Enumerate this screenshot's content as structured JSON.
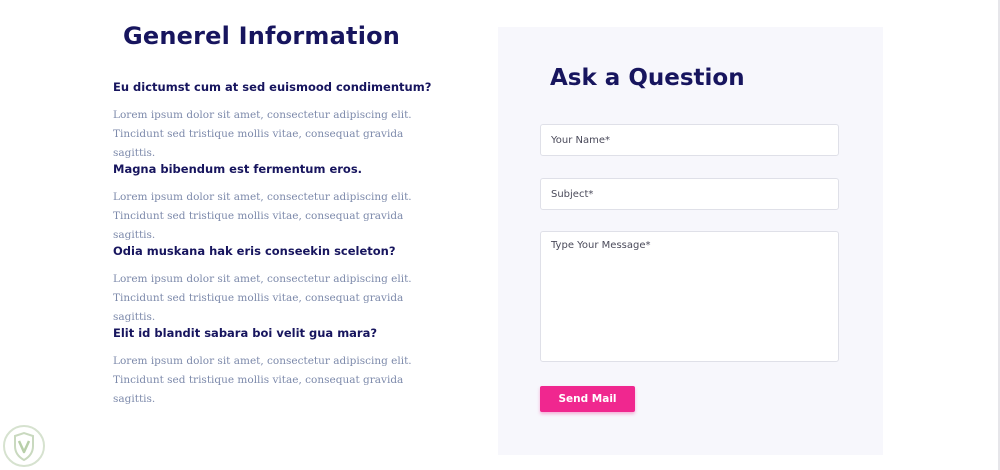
{
  "info": {
    "title": "Generel Information",
    "items": [
      {
        "question": "Eu dictumst cum at sed euismood condimentum?",
        "answer": "Lorem ipsum dolor sit amet, consectetur adipiscing elit. Tincidunt sed tristique mollis vitae, consequat gravida sagittis."
      },
      {
        "question": "Magna bibendum est fermentum eros.",
        "answer": "Lorem ipsum dolor sit amet, consectetur adipiscing elit. Tincidunt sed tristique mollis vitae, consequat gravida sagittis."
      },
      {
        "question": "Odia muskana hak eris conseekin sceleton?",
        "answer": "Lorem ipsum dolor sit amet, consectetur adipiscing elit. Tincidunt sed tristique mollis vitae, consequat gravida sagittis."
      },
      {
        "question": "Elit id blandit sabara boi velit gua mara?",
        "answer": "Lorem ipsum dolor sit amet, consectetur adipiscing elit. Tincidunt sed tristique mollis vitae, consequat gravida sagittis."
      }
    ]
  },
  "form": {
    "title": "Ask a Question",
    "name_placeholder": "Your Name*",
    "name_value": "",
    "subject_placeholder": "Subject*",
    "subject_value": "",
    "message_placeholder": "Type Your Message*",
    "message_value": "",
    "submit_label": "Send Mail"
  },
  "colors": {
    "heading": "#17155e",
    "body_text": "#7d8aab",
    "panel_bg": "#f7f7fc",
    "accent": "#f0278f"
  },
  "icons": {
    "watermark": "shield-logo-icon"
  }
}
